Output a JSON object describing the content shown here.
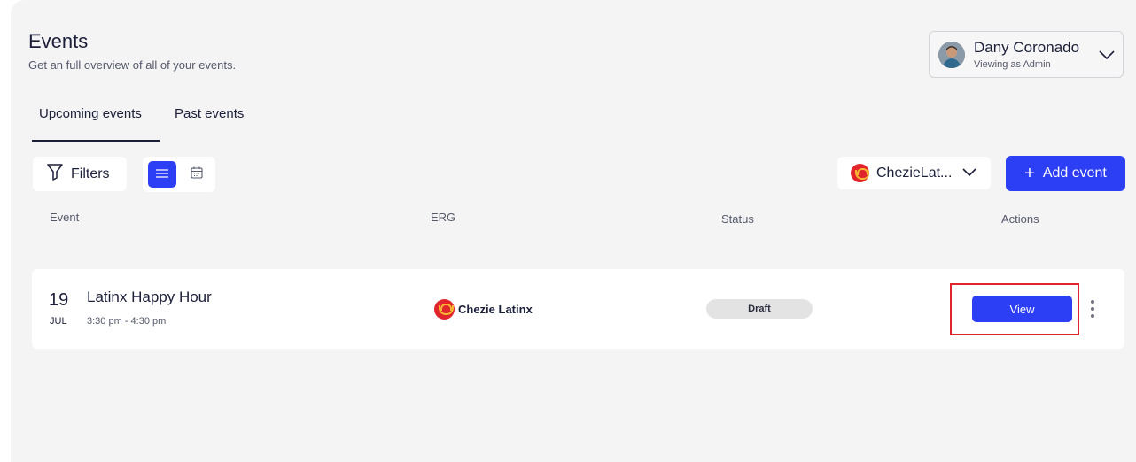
{
  "header": {
    "title": "Events",
    "subtitle": "Get an full overview of all of your events."
  },
  "user": {
    "name": "Dany Coronado",
    "role": "Viewing as Admin"
  },
  "tabs": [
    {
      "label": "Upcoming events",
      "active": true
    },
    {
      "label": "Past events",
      "active": false
    }
  ],
  "toolbar": {
    "filters_label": "Filters",
    "view_mode": "list",
    "erg_select_label": "ChezieLat...",
    "add_event_label": "Add event"
  },
  "table": {
    "columns": [
      "Event",
      "ERG",
      "Status",
      "Actions"
    ],
    "rows": [
      {
        "day": "19",
        "month": "JUL",
        "title": "Latinx Happy Hour",
        "time": "3:30 pm - 4:30 pm",
        "erg": "Chezie Latinx",
        "status": "Draft",
        "action_label": "View"
      }
    ]
  },
  "colors": {
    "accent": "#2d3ff5",
    "background": "#f4f4f4",
    "highlight": "#e0262c",
    "status_draft_bg": "#e3e3e3"
  }
}
